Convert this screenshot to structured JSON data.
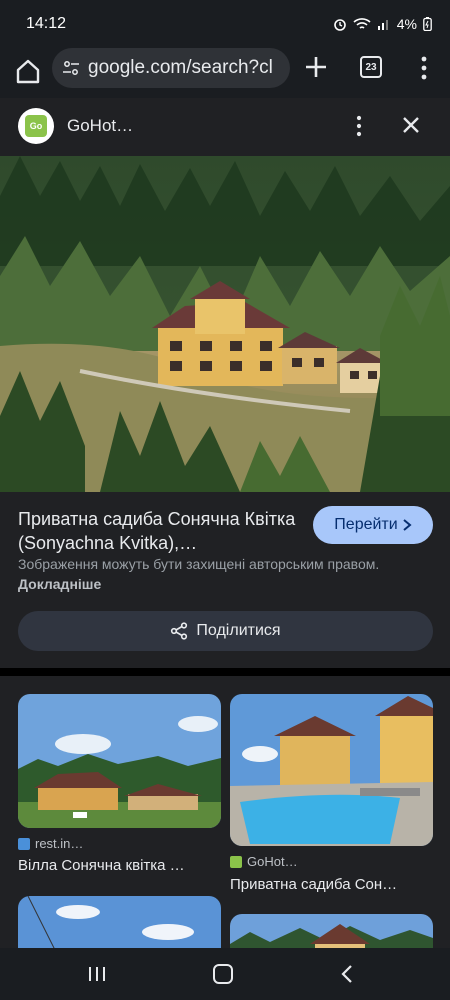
{
  "status": {
    "time": "14:12",
    "battery": "4%"
  },
  "browser": {
    "url": "google.com/search?cl",
    "tab_count": "23"
  },
  "panel": {
    "site_name": "GoHot…",
    "logo_text": "Go",
    "title": "Приватна садиба Сонячна Квітка (Sonyachna Kvitka),…",
    "visit_label": "Перейти",
    "copyright_text": "Зображення можуть бути захищені авторським правом.",
    "learn_more": "Докладніше",
    "share_label": "Поділитися"
  },
  "related": [
    {
      "source": "rest.in…",
      "title": "Вілла Сонячна квітка …"
    },
    {
      "source": "GoHot…",
      "title": "Приватна садиба Сон…"
    }
  ],
  "colors": {
    "background": "#202124",
    "accent_button": "#a8c7fa",
    "share_button": "#303540"
  }
}
